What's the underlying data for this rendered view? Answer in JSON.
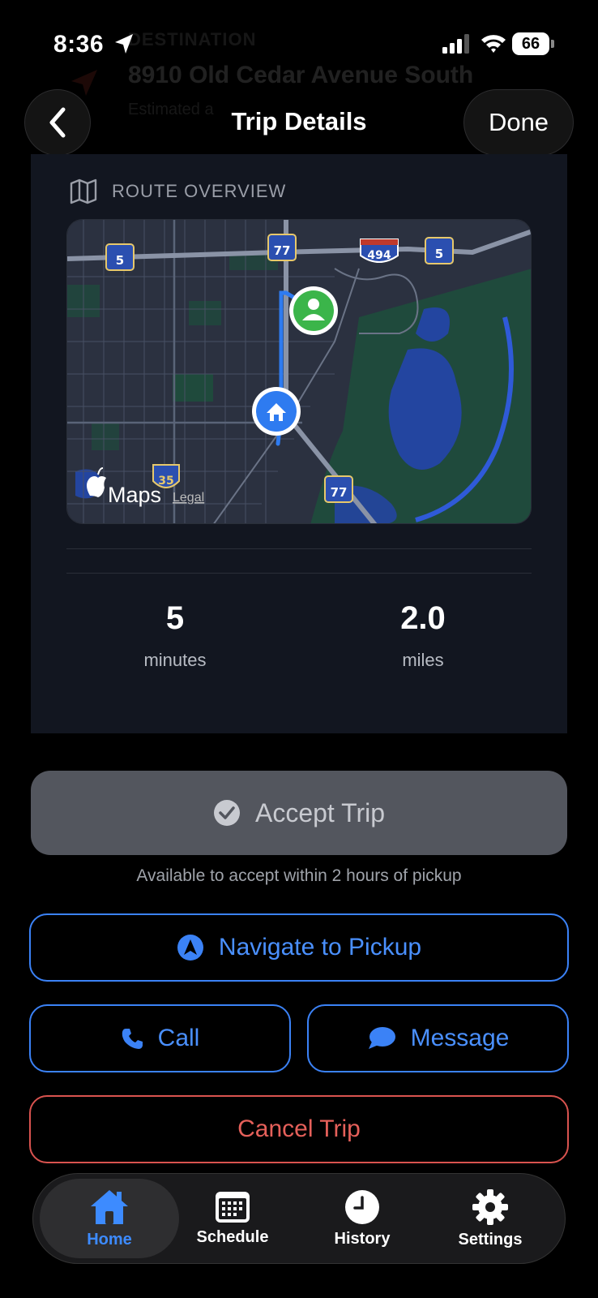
{
  "status_bar": {
    "time": "8:36",
    "battery": "66"
  },
  "background": {
    "label": "DESTINATION",
    "address": "8910 Old Cedar Avenue South",
    "sub": "Estimated a"
  },
  "nav": {
    "title": "Trip Details",
    "done_label": "Done"
  },
  "route": {
    "header": "ROUTE OVERVIEW",
    "map": {
      "shields": [
        "5",
        "77",
        "494",
        "5",
        "35",
        "77"
      ],
      "attribution": "Maps",
      "legal": "Legal"
    },
    "stats": [
      {
        "value": "5",
        "unit": "minutes"
      },
      {
        "value": "2.0",
        "unit": "miles"
      }
    ]
  },
  "actions": {
    "accept_label": "Accept Trip",
    "accept_note": "Available to accept within 2 hours of pickup",
    "navigate_label": "Navigate to Pickup",
    "call_label": "Call",
    "message_label": "Message",
    "cancel_label": "Cancel Trip"
  },
  "tabs": [
    {
      "label": "Home",
      "icon": "home-icon",
      "active": true
    },
    {
      "label": "Schedule",
      "icon": "calendar-icon",
      "active": false
    },
    {
      "label": "History",
      "icon": "clock-icon",
      "active": false
    },
    {
      "label": "Settings",
      "icon": "gear-icon",
      "active": false
    }
  ],
  "colors": {
    "accent": "#3b82f6",
    "danger": "#d9534f",
    "card": "#121620"
  }
}
